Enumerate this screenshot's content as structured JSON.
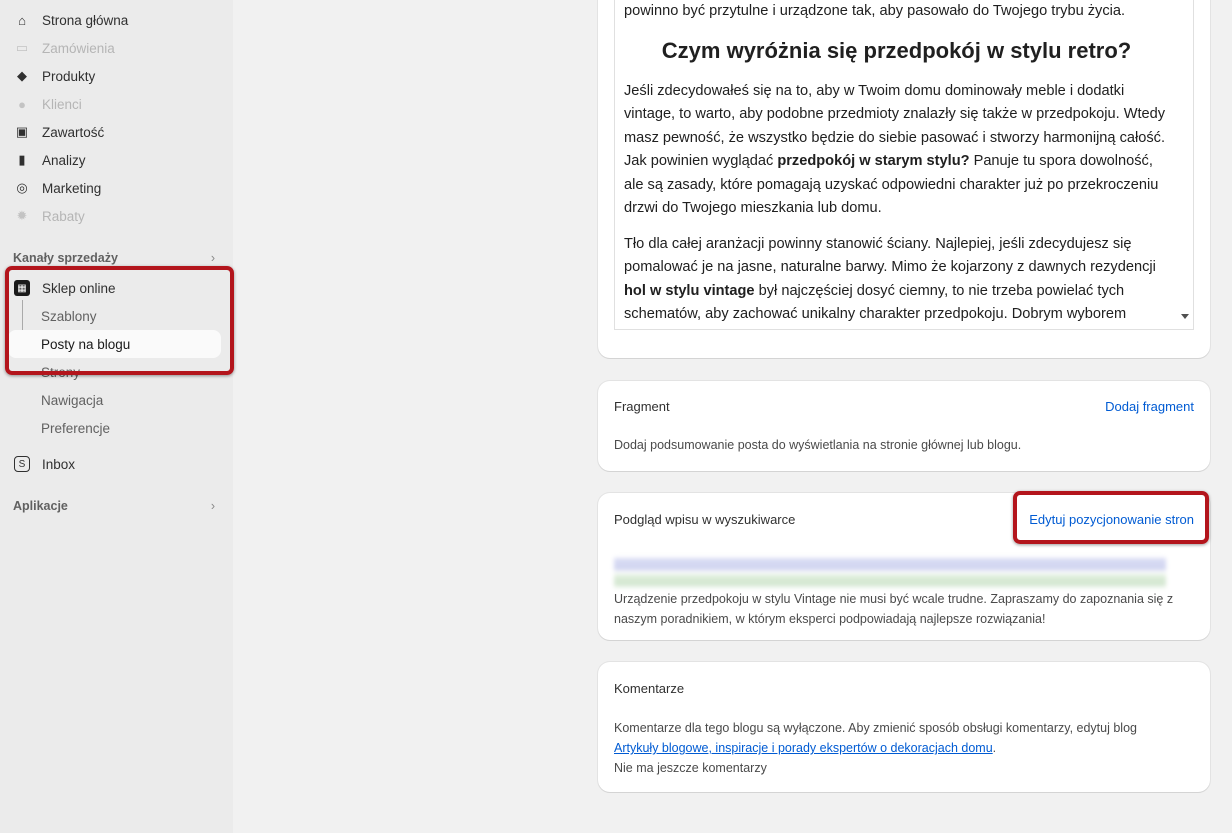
{
  "sidebar": {
    "items": [
      {
        "label": "Strona główna",
        "icon": "home-icon",
        "glyph": "⌂"
      },
      {
        "label": "Zamówienia",
        "icon": "inbox-tray-icon",
        "glyph": "▭"
      },
      {
        "label": "Produkty",
        "icon": "tag-icon",
        "glyph": "◆"
      },
      {
        "label": "Klienci",
        "icon": "person-icon",
        "glyph": "●"
      },
      {
        "label": "Zawartość",
        "icon": "content-icon",
        "glyph": "▣"
      },
      {
        "label": "Analizy",
        "icon": "bar-chart-icon",
        "glyph": "▮"
      },
      {
        "label": "Marketing",
        "icon": "target-icon",
        "glyph": "◎"
      },
      {
        "label": "Rabaty",
        "icon": "discount-icon",
        "glyph": "✹"
      }
    ],
    "sales_channels": "Kanały sprzedaży",
    "online_store": "Sklep online",
    "sub_items": [
      "Szablony",
      "Posty na blogu",
      "Strony",
      "Nawigacja",
      "Preferencje"
    ],
    "inbox": "Inbox",
    "apps": "Aplikacje",
    "chevron": "›"
  },
  "editor": {
    "top_line": "powinno być przytulne i urządzone tak, aby pasowało do Twojego trybu życia.",
    "heading": "Czym wyróżnia się przedpokój w stylu retro?",
    "p1a": "Jeśli zdecydowałeś się na to, aby w Twoim domu dominowały meble i dodatki vintage, to warto, aby podobne przedmioty znalazły się także w przedpokoju. Wtedy masz pewność, że wszystko będzie do siebie pasować i stworzy harmonijną całość. Jak powinien wyglądać ",
    "p1b": "przedpokój w starym stylu?",
    "p1c": " Panuje tu spora dowolność, ale są zasady, które pomagają uzyskać odpowiedni charakter już po przekroczeniu drzwi do Twojego mieszkania lub domu.",
    "p2a": "Tło dla całej aranżacji powinny stanowić ściany. Najlepiej, jeśli zdecydujesz się pomalować je na jasne, naturalne barwy. Mimo że kojarzony z dawnych rezydencji ",
    "p2b": "hol w stylu vintage",
    "p2c": " był najczęściej dosyć ciemny, to nie trzeba powielać tych schematów, aby zachować unikalny charakter przedpokoju. Dobrym wyborem będzie też tapeta, która stanowi neutralne tło i doskonale eksponuje wszelkie dodatki."
  },
  "fragment": {
    "title": "Fragment",
    "action": "Dodaj fragment",
    "text": "Dodaj podsumowanie posta do wyświetlania na stronie głównej lub blogu."
  },
  "seo": {
    "title": "Podgląd wpisu w wyszukiwarce",
    "action": "Edytuj pozycjonowanie stron",
    "description": "Urządzenie przedpokoju w stylu Vintage nie musi być wcale trudne. Zapraszamy do zapoznania się z naszym poradnikiem, w którym eksperci podpowiadają najlepsze rozwiązania!"
  },
  "comments": {
    "title": "Komentarze",
    "text": "Komentarze dla tego blogu są wyłączone. Aby zmienić sposób obsługi komentarzy, edytuj blog",
    "blog_link": "Artykuły blogowe, inspiracje i porady ekspertów o dekoracjach domu",
    "blog_link_suffix": ".",
    "none": "Nie ma jeszcze komentarzy"
  },
  "colors": {
    "highlight": "#b3151c",
    "link": "#005bd3"
  }
}
